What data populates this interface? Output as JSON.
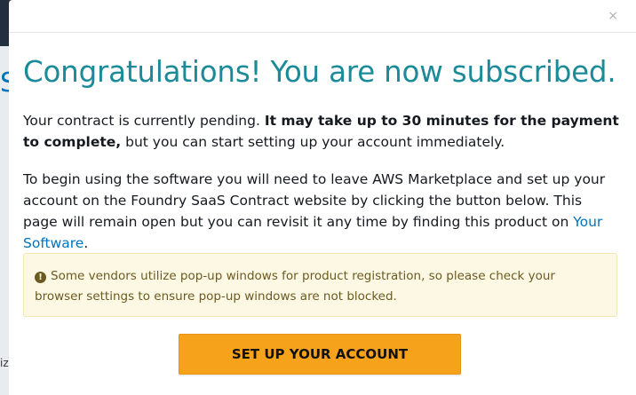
{
  "modal": {
    "close_glyph": "×",
    "title": "Congratulations! You are now subscribed.",
    "paragraph1": {
      "text_before": "Your contract is currently pending. ",
      "bold_text": "It may take up to 30 minutes for the payment to complete,",
      "text_after": " but you can start setting up your account immediately."
    },
    "paragraph2": {
      "text_before": "To begin using the software you will need to leave AWS Marketplace and set up your account on the Foundry SaaS Contract website by clicking the button below. This page will remain open but you can revisit it any time by finding this product on ",
      "link_text": "Your Software",
      "text_after": "."
    },
    "alert": {
      "icon": "exclamation-circle-icon",
      "text": "Some vendors utilize pop-up windows for product registration, so please check your browser settings to ensure pop-up windows are not blocked."
    },
    "cta_label": "SET UP YOUR ACCOUNT"
  },
  "background": {
    "partial_heading": "S",
    "partial_text": "iz"
  },
  "colors": {
    "title": "#1b8a99",
    "link": "#0073bb",
    "cta": "#f7a21b",
    "alert_bg": "#fcf8e3"
  }
}
